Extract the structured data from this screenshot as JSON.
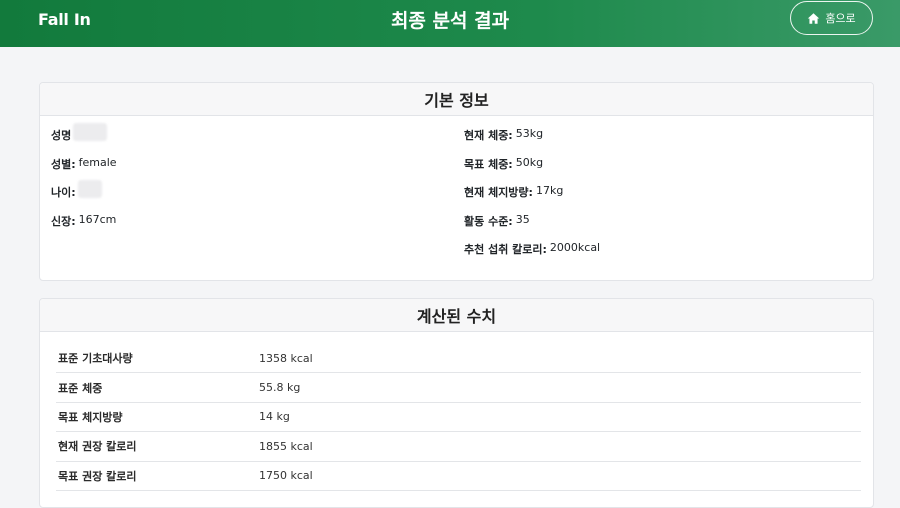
{
  "header": {
    "brand": "Fall In",
    "title": "최종 분석 결과",
    "home_label": "홈으로",
    "home_icon": "home-icon"
  },
  "basic_info": {
    "title": "기본 정보",
    "left": [
      {
        "label": "성명",
        "value": "",
        "redacted": true
      },
      {
        "label": "성별:",
        "value": "female"
      },
      {
        "label": "나이:",
        "value": "",
        "redacted": true
      },
      {
        "label": "신장:",
        "value": "167cm"
      }
    ],
    "right": [
      {
        "label": "현재 체중:",
        "value": "53kg"
      },
      {
        "label": "목표 체중:",
        "value": "50kg"
      },
      {
        "label": "현재 체지방량:",
        "value": "17kg"
      },
      {
        "label": "활동 수준:",
        "value": "35"
      },
      {
        "label": "추천 섭취 칼로리:",
        "value": "2000kcal"
      }
    ]
  },
  "calculated": {
    "title": "계산된 수치",
    "rows": [
      {
        "label": "표준 기초대사량",
        "value": "1358 kcal"
      },
      {
        "label": "표준 체중",
        "value": "55.8 kg"
      },
      {
        "label": "목표 체지방량",
        "value": "14 kg"
      },
      {
        "label": "현재 권장 칼로리",
        "value": "1855 kcal"
      },
      {
        "label": "목표 권장 칼로리",
        "value": "1750 kcal"
      }
    ]
  },
  "colors": {
    "header_start": "#127a3c",
    "header_end": "#3a9a68",
    "background": "#f4f5f7"
  }
}
